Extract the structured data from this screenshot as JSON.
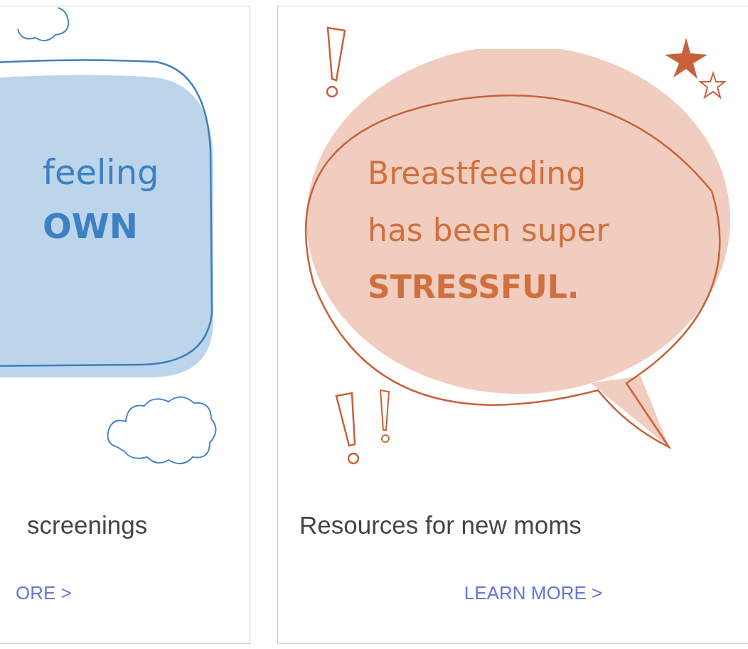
{
  "cards": [
    {
      "bubble": {
        "kind": "rounded",
        "text": "feeling **OWN**"
      },
      "caption": "screenings",
      "link": "ORE >"
    },
    {
      "bubble": {
        "kind": "speech",
        "text": "Breastfeeding has been super **STRESSFUL.**"
      },
      "caption": "Resources for new moms",
      "link": "LEARN MORE >"
    }
  ]
}
